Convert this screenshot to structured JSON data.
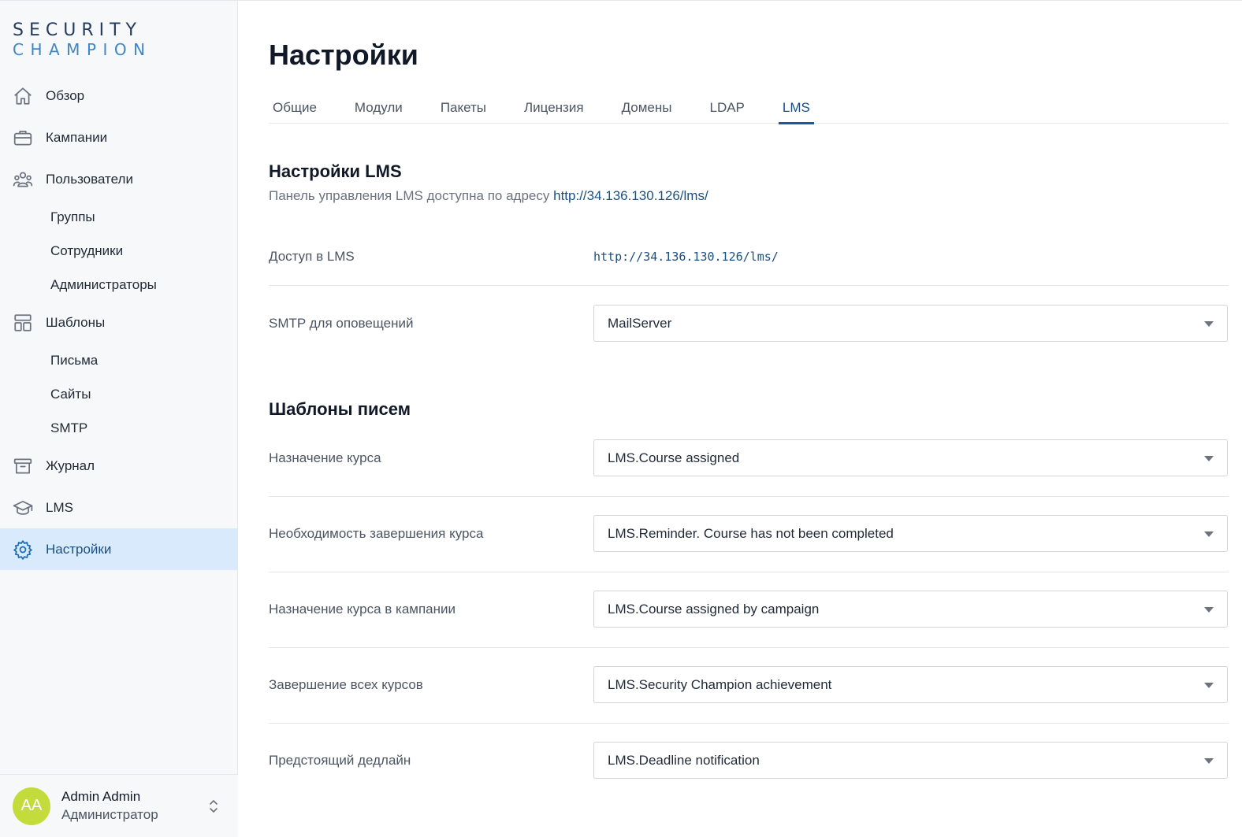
{
  "logo": {
    "line1": "SECURITY",
    "line2": "CHAMPION"
  },
  "sidebar": {
    "items": [
      {
        "label": "Обзор",
        "icon": "home-icon"
      },
      {
        "label": "Кампании",
        "icon": "briefcase-icon"
      },
      {
        "label": "Пользователи",
        "icon": "users-icon"
      },
      {
        "label": "Группы"
      },
      {
        "label": "Сотрудники"
      },
      {
        "label": "Администраторы"
      },
      {
        "label": "Шаблоны",
        "icon": "layout-icon"
      },
      {
        "label": "Письма"
      },
      {
        "label": "Сайты"
      },
      {
        "label": "SMTP"
      },
      {
        "label": "Журнал",
        "icon": "archive-icon"
      },
      {
        "label": "LMS",
        "icon": "graduation-cap-icon"
      },
      {
        "label": "Настройки",
        "icon": "gear-icon",
        "active": true
      }
    ]
  },
  "user": {
    "initials": "AA",
    "name": "Admin Admin",
    "role": "Администратор",
    "avatar_color": "#c3dc3b"
  },
  "page": {
    "title": "Настройки",
    "tabs": [
      "Общие",
      "Модули",
      "Пакеты",
      "Лицензия",
      "Домены",
      "LDAP",
      "LMS"
    ],
    "active_tab": "LMS"
  },
  "lms_settings": {
    "title": "Настройки LMS",
    "desc_prefix": "Панель управления LMS доступна по адресу",
    "desc_link": "http://34.136.130.126/lms/",
    "access_label": "Доступ в LMS",
    "access_value": "http://34.136.130.126/lms/",
    "smtp_label": "SMTP для оповещений",
    "smtp_value": "MailServer"
  },
  "templates": {
    "title": "Шаблоны писем",
    "rows": [
      {
        "label": "Назначение курса",
        "value": "LMS.Course assigned"
      },
      {
        "label": "Необходимость завершения курса",
        "value": "LMS.Reminder. Course has not been completed"
      },
      {
        "label": "Назначение курса в кампании",
        "value": "LMS.Course assigned by campaign"
      },
      {
        "label": "Завершение всех курсов",
        "value": "LMS.Security Champion achievement"
      },
      {
        "label": "Предстоящий дедлайн",
        "value": "LMS.Deadline notification"
      }
    ]
  },
  "colors": {
    "accent": "#1a4f86",
    "active_bg": "#d8eafb",
    "tab_underline": "#1a5a9c"
  }
}
